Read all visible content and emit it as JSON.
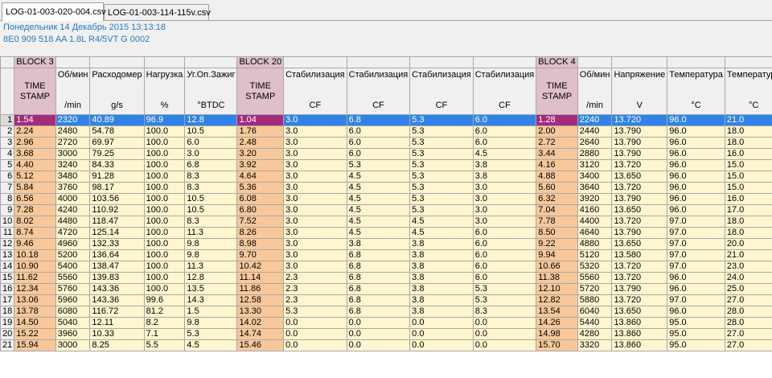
{
  "tabs": [
    {
      "label": "LOG-01-003-020-004.csv",
      "active": true
    },
    {
      "label": "LOG-01-003-114-115v.csv",
      "active": false
    }
  ],
  "info": {
    "date_line": "Понедельник 14 Декабрь 2015 13:13:18",
    "car_line": "8E0 909 518 AA  1.8L R4/5VT     G   0002"
  },
  "colors": {
    "accent_text": "#2a7ac0",
    "selection": "#2f83e8",
    "timestamp_selected": "#a42a7c",
    "cell_bg": "#fff6cf",
    "timestamp_bg": "#f8c89a"
  },
  "sheet": {
    "blocks": [
      "BLOCK 3",
      "BLOCK 20",
      "BLOCK 4"
    ],
    "columns": [
      {
        "top": "TIME\nSTAMP",
        "unit": ""
      },
      {
        "top": "Об/мин",
        "unit": "/min"
      },
      {
        "top": "Расходомер",
        "unit": "g/s"
      },
      {
        "top": "Нагрузка",
        "unit": "%"
      },
      {
        "top": "Уг.Оп.Зажиг",
        "unit": "°BTDC"
      },
      {
        "top": "TIME\nSTAMP",
        "unit": ""
      },
      {
        "top": "Стабилизация",
        "unit": "CF"
      },
      {
        "top": "Стабилизация",
        "unit": "CF"
      },
      {
        "top": "Стабилизация",
        "unit": "CF"
      },
      {
        "top": "Стабилизация",
        "unit": "CF"
      },
      {
        "top": "TIME\nSTAMP",
        "unit": ""
      },
      {
        "top": "Об/мин",
        "unit": "/min"
      },
      {
        "top": "Напряжение",
        "unit": "V"
      },
      {
        "top": "Температура",
        "unit": "°C"
      },
      {
        "top": "Температура",
        "unit": "°C"
      }
    ],
    "selected_row": 1,
    "rows": [
      [
        "1.54",
        "2320",
        "40.89",
        "96.9",
        "12.8",
        "1.04",
        "3.0",
        "6.8",
        "5.3",
        "6.0",
        "1.28",
        "2240",
        "13.720",
        "96.0",
        "21.0"
      ],
      [
        "2.24",
        "2480",
        "54.78",
        "100.0",
        "10.5",
        "1.76",
        "3.0",
        "6.0",
        "5.3",
        "6.0",
        "2.00",
        "2440",
        "13.790",
        "96.0",
        "18.0"
      ],
      [
        "2.96",
        "2720",
        "69.97",
        "100.0",
        "6.0",
        "2.48",
        "3.0",
        "6.0",
        "5.3",
        "6.0",
        "2.72",
        "2640",
        "13.790",
        "96.0",
        "18.0"
      ],
      [
        "3.68",
        "3000",
        "79.25",
        "100.0",
        "3.0",
        "3.20",
        "3.0",
        "6.0",
        "5.3",
        "4.5",
        "3.44",
        "2880",
        "13.790",
        "96.0",
        "16.0"
      ],
      [
        "4.40",
        "3240",
        "84.33",
        "100.0",
        "6.8",
        "3.92",
        "3.0",
        "5.3",
        "5.3",
        "3.8",
        "4.16",
        "3120",
        "13.720",
        "96.0",
        "15.0"
      ],
      [
        "5.12",
        "3480",
        "91.28",
        "100.0",
        "8.3",
        "4.64",
        "3.0",
        "4.5",
        "5.3",
        "3.8",
        "4.88",
        "3400",
        "13.650",
        "96.0",
        "15.0"
      ],
      [
        "5.84",
        "3760",
        "98.17",
        "100.0",
        "8.3",
        "5.36",
        "3.0",
        "4.5",
        "5.3",
        "3.0",
        "5.60",
        "3640",
        "13.720",
        "96.0",
        "15.0"
      ],
      [
        "6.56",
        "4000",
        "103.56",
        "100.0",
        "10.5",
        "6.08",
        "3.0",
        "4.5",
        "5.3",
        "3.0",
        "6.32",
        "3920",
        "13.790",
        "96.0",
        "16.0"
      ],
      [
        "7.28",
        "4240",
        "110.92",
        "100.0",
        "10.5",
        "6.80",
        "3.0",
        "4.5",
        "5.3",
        "3.0",
        "7.04",
        "4160",
        "13.650",
        "96.0",
        "17.0"
      ],
      [
        "8.02",
        "4480",
        "118.47",
        "100.0",
        "8.3",
        "7.52",
        "3.0",
        "4.5",
        "4.5",
        "3.0",
        "7.78",
        "4400",
        "13.720",
        "97.0",
        "18.0"
      ],
      [
        "8.74",
        "4720",
        "125.14",
        "100.0",
        "11.3",
        "8.26",
        "3.0",
        "4.5",
        "4.5",
        "6.0",
        "8.50",
        "4640",
        "13.790",
        "97.0",
        "18.0"
      ],
      [
        "9.46",
        "4960",
        "132.33",
        "100.0",
        "9.8",
        "8.98",
        "3.0",
        "3.8",
        "3.8",
        "6.0",
        "9.22",
        "4880",
        "13.650",
        "97.0",
        "20.0"
      ],
      [
        "10.18",
        "5200",
        "136.64",
        "100.0",
        "9.8",
        "9.70",
        "3.0",
        "6.8",
        "3.8",
        "6.0",
        "9.94",
        "5120",
        "13.580",
        "97.0",
        "21.0"
      ],
      [
        "10.90",
        "5400",
        "138.47",
        "100.0",
        "11.3",
        "10.42",
        "3.0",
        "6.8",
        "3.8",
        "6.0",
        "10.66",
        "5320",
        "13.720",
        "97.0",
        "23.0"
      ],
      [
        "11.62",
        "5560",
        "139.83",
        "100.0",
        "12.8",
        "11.14",
        "2.3",
        "6.8",
        "3.8",
        "6.0",
        "11.38",
        "5560",
        "13.720",
        "96.0",
        "24.0"
      ],
      [
        "12.34",
        "5760",
        "143.36",
        "100.0",
        "13.5",
        "11.86",
        "2.3",
        "6.8",
        "3.8",
        "5.3",
        "12.10",
        "5720",
        "13.790",
        "96.0",
        "25.0"
      ],
      [
        "13.06",
        "5960",
        "143.36",
        "99.6",
        "14.3",
        "12.58",
        "2.3",
        "6.8",
        "3.8",
        "5.3",
        "12.82",
        "5880",
        "13.720",
        "97.0",
        "27.0"
      ],
      [
        "13.78",
        "6080",
        "116.72",
        "81.2",
        "1.5",
        "13.30",
        "5.3",
        "6.8",
        "3.8",
        "8.3",
        "13.54",
        "6040",
        "13.650",
        "96.0",
        "28.0"
      ],
      [
        "14.50",
        "5040",
        "12.11",
        "8.2",
        "9.8",
        "14.02",
        "0.0",
        "0.0",
        "0.0",
        "0.0",
        "14.26",
        "5440",
        "13.860",
        "95.0",
        "28.0"
      ],
      [
        "15.22",
        "3960",
        "10.33",
        "7.1",
        "5.3",
        "14.74",
        "0.0",
        "0.0",
        "0.0",
        "0.0",
        "14.98",
        "4280",
        "13.860",
        "95.0",
        "27.0"
      ],
      [
        "15.94",
        "3000",
        "8.25",
        "5.5",
        "4.5",
        "15.46",
        "0.0",
        "0.0",
        "0.0",
        "0.0",
        "15.70",
        "3320",
        "13.860",
        "95.0",
        "27.0"
      ]
    ]
  }
}
